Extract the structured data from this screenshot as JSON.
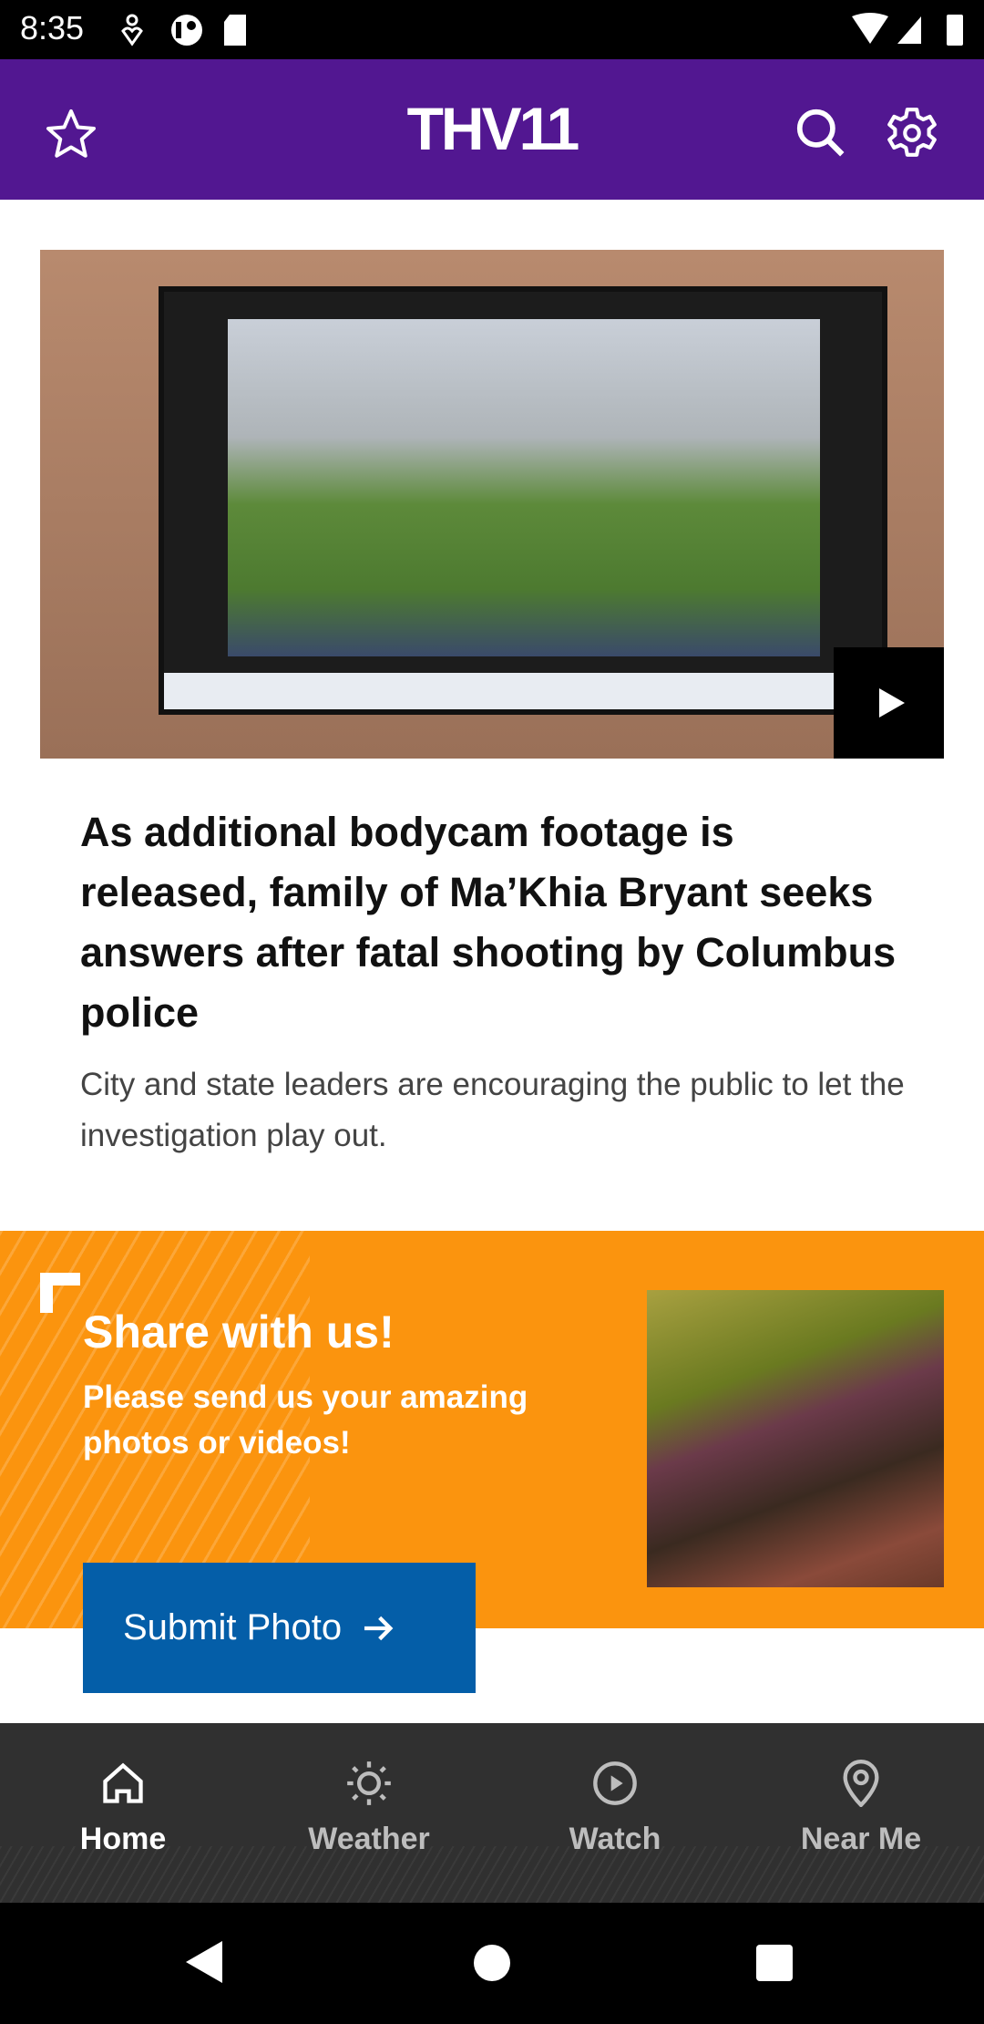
{
  "status_bar": {
    "time": "8:35",
    "icons": [
      "location-heart-icon",
      "app-notification-icon",
      "sd-card-icon",
      "wifi-icon",
      "signal-icon",
      "battery-icon"
    ]
  },
  "header": {
    "logo": "THV11",
    "left_icon": "star-icon",
    "right_icons": [
      "search-icon",
      "gear-icon"
    ],
    "color": "#521791"
  },
  "hero": {
    "has_video": true,
    "play_icon": "play-icon"
  },
  "article": {
    "headline": "As additional bodycam footage is released, family of Ma’Khia Bryant seeks answers after fatal shooting by Columbus police",
    "subtitle": "City and state leaders are encouraging the public to let the investigation play out."
  },
  "promo": {
    "title": "Share with us!",
    "text": "Please send us your amazing photos or videos!",
    "button_label": "Submit Photo",
    "button_icon": "arrow-right-icon",
    "color": "#fb940e",
    "button_color": "#045ea8"
  },
  "bottom_nav": {
    "items": [
      {
        "label": "Home",
        "icon": "home-icon",
        "active": true
      },
      {
        "label": "Weather",
        "icon": "sun-icon"
      },
      {
        "label": "Watch",
        "icon": "play-circle-icon"
      },
      {
        "label": "Near Me",
        "icon": "location-pin-icon"
      }
    ]
  },
  "system_nav": [
    "back-icon",
    "home-circle-icon",
    "recents-icon"
  ]
}
